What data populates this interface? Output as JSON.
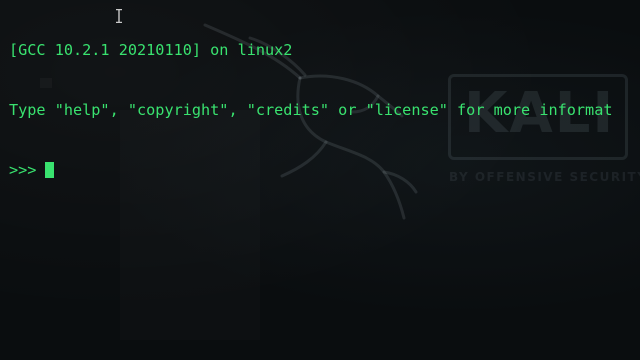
{
  "terminal": {
    "lines": [
      "[GCC 10.2.1 20210110] on linux2",
      "Type \"help\", \"copyright\", \"credits\" or \"license\" for more informat"
    ],
    "prompt": ">>>",
    "text_color": "#39e26f",
    "background_color": "#0a0d0f"
  },
  "wallpaper": {
    "logo_text": "KALI",
    "tagline": "BY OFFENSIVE SECURITY",
    "icon": "kali-dragon-icon"
  },
  "pointer": {
    "icon": "text-ibeam-cursor-icon"
  }
}
